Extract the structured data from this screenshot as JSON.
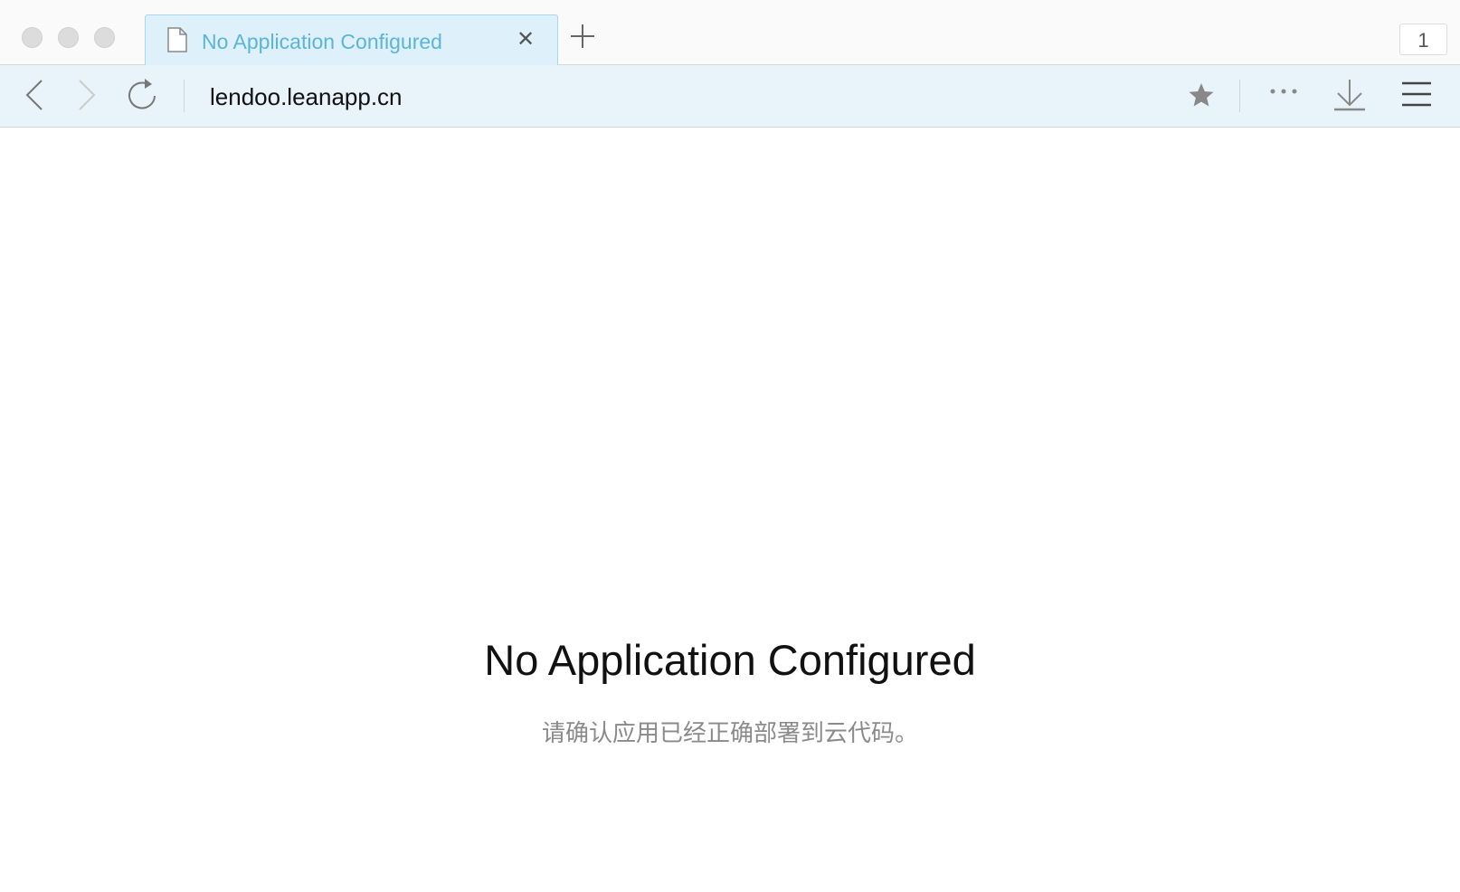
{
  "browser": {
    "tab": {
      "title": "No Application Configured",
      "icon": "document-icon"
    },
    "tab_count": "1",
    "address": "lendoo.leanapp.cn",
    "accent": "#5ab4dc"
  },
  "page": {
    "title": "No Application Configured",
    "message": "请确认应用已经正确部署到云代码。"
  }
}
